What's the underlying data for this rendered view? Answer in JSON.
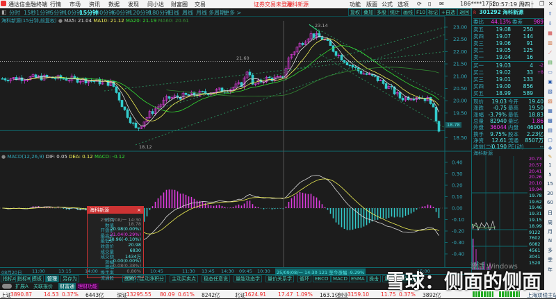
{
  "app": {
    "title": "通达信金融终端",
    "menu": [
      "行情",
      "市场",
      "资讯",
      "数据",
      "发现",
      "问小达",
      "财富圈",
      "交易"
    ],
    "trade_status": "证券交易未登录",
    "stock_name": "海科新源",
    "menu_right": [
      "功能",
      "版面",
      "公式",
      "选项"
    ],
    "user": "186****1762",
    "clock": "10:57:19 周四"
  },
  "periods": [
    "分时",
    "15秒",
    "1分钟",
    "5分钟",
    "10分钟",
    "15分钟",
    "30分钟",
    "60分钟",
    "120分钟",
    "180分钟",
    "日线",
    "周线",
    "月线",
    "多周期",
    "更多 >"
  ],
  "active_period": "15分钟",
  "tools": [
    "复权",
    "叠加",
    "多股",
    "统计",
    "画线",
    "F10",
    "标记",
    "+自选",
    "返回"
  ],
  "ma_legend": {
    "title": "海科新源(15分钟,前复权)",
    "ma5": "MA5: 21.04",
    "ma10": "MA10: 21.12",
    "ma20": "MA20: 21.19",
    "ma60": "MA60: 20.61"
  },
  "annotations": {
    "high": "23.14",
    "mid": "21.60",
    "low": "18.12"
  },
  "price_axis": [
    "23.00",
    "22.50",
    "22.00",
    "21.50",
    "21.00",
    "20.50",
    "20.00",
    "19.50",
    "18.50"
  ],
  "current_price_tag": "18.78",
  "macd_legend": {
    "title": "MACD(12,26,9)",
    "dif": "DIF: 0.05",
    "dea": "DEA: 0.12",
    "macd": "MACD: -0.12"
  },
  "macd_axis": [
    "0.40",
    "0.30",
    "0.20",
    "0.10",
    "0.00",
    "-0.10",
    "-0.20",
    "-0.30",
    "-0.40"
  ],
  "quote": {
    "code": "301292",
    "name": "海科新源",
    "wb_label": "委比",
    "wb": "44.13%",
    "wc_label": "委差",
    "wc": "989",
    "asks": [
      [
        "卖五",
        "19.08",
        "250"
      ],
      [
        "卖四",
        "19.07",
        "144"
      ],
      [
        "卖三",
        "19.06",
        "91"
      ],
      [
        "卖二",
        "19.05",
        "125"
      ],
      [
        "卖一",
        "19.04",
        "16"
      ]
    ],
    "bids": [
      [
        "买一",
        "19.03",
        "4",
        "-2"
      ],
      [
        "买二",
        "19.02",
        "33",
        "+8"
      ],
      [
        "买三",
        "19.01",
        "133",
        ""
      ],
      [
        "买四",
        "19.00",
        "856",
        ""
      ],
      [
        "买五",
        "18.99",
        "589",
        ""
      ]
    ],
    "stats": [
      [
        "现价",
        "19.03",
        "今开",
        "19.40"
      ],
      [
        "涨跌",
        "-0.75",
        "最高",
        "19.50"
      ],
      [
        "涨幅",
        "-3.79%",
        "最低",
        "18.83"
      ],
      [
        "总量",
        "82940",
        "量比",
        "1.86"
      ],
      [
        "外盘",
        "36044",
        "内盘",
        "46904"
      ],
      [
        "换手",
        "9.75%",
        "股本",
        "2.23亿"
      ],
      [
        "净资",
        "12.61",
        "流通",
        "8507万"
      ],
      [
        "收益(二)",
        "-0.190",
        "PE(动)",
        "--"
      ]
    ]
  },
  "mini": {
    "title": "海科新源",
    "axis": [
      "20.73",
      "20.57",
      "20.41",
      "20.26",
      "20.10",
      "19.94",
      "19.78",
      "19.62",
      "19.46",
      "19.31",
      "19.15",
      "18.99",
      "9122",
      "7602",
      "6082",
      "4561",
      "3041",
      "1520"
    ]
  },
  "vtools": [
    "1",
    "5",
    "15",
    "30",
    "60",
    "日",
    "周",
    "月",
    "N",
    "多",
    "季",
    "年"
  ],
  "tooltip": {
    "title": "海科新源",
    "rows": [
      [
        "时间",
        "25/09/08/一 14:30"
      ],
      [
        "数值",
        "18.78"
      ],
      [
        "开盘价",
        "20.98(0.00%)"
      ],
      [
        "最高价",
        "21.04(0.29%)"
      ],
      [
        "最低价",
        "20.96(-0.10%)"
      ],
      [
        "收盘价",
        "20.98"
      ],
      [
        "成交量",
        "6830"
      ],
      [
        "成交额",
        "1434万"
      ],
      [
        "涨幅",
        "0.00(0.00%)"
      ],
      [
        "振幅",
        "0.08(0.38%)"
      ],
      [
        "换手率",
        "0.80%"
      ],
      [
        "流通股",
        "8507万"
      ]
    ]
  },
  "time_axis": [
    "08月20日",
    "11:00",
    "13:15",
    "14:00",
    "10:45",
    "11:30",
    "13:45",
    "14:30",
    "09:45",
    "10:30",
    "15:00"
  ],
  "time_highlight": "25/09/08/一 14:30 121 至今涨幅 -9.29%",
  "tabs": [
    "指标A",
    "指标B",
    "模板",
    "管理",
    "另存为",
    "回购",
    "主动净积分",
    "主动买卖点",
    "稳态任意说",
    "量能动态学",
    "量价关系学",
    "循环",
    "EBCO",
    "MACD",
    "ESMA",
    "操击",
    "量能",
    "量能分析"
  ],
  "tabs2": [
    "扩展A",
    "关联报价",
    "财富通",
    "理财功能"
  ],
  "status": [
    [
      "上证",
      "3890.87",
      "14.53",
      "0.37%",
      "6443亿"
    ],
    [
      "深证",
      "13295.55",
      "80.09",
      "0.61%",
      "8242亿"
    ],
    [
      "北证",
      "1624.91",
      "17.47",
      "1.09%",
      "163.1亿"
    ],
    [
      "创业",
      "3159.10",
      "11.75",
      "0.37%",
      "3892亿"
    ]
  ],
  "server": "上海双线主站",
  "watermark": "雪球：侧面的侧面",
  "win_watermark": "激活 Windows"
}
